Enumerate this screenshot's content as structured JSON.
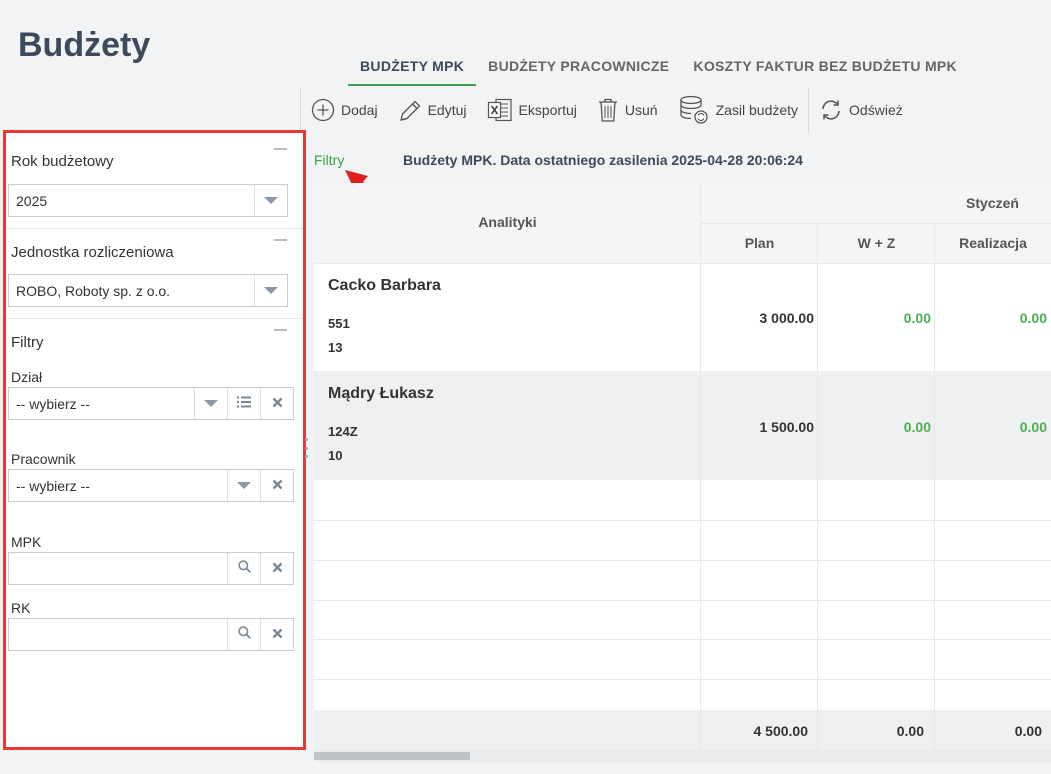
{
  "page": {
    "title": "Budżety"
  },
  "tabs": [
    "BUDŻETY MPK",
    "BUDŻETY PRACOWNICZE",
    "KOSZTY FAKTUR BEZ BUDŻETU MPK"
  ],
  "toolbar": {
    "add": "Dodaj",
    "edit": "Edytuj",
    "export": "Eksportuj",
    "delete": "Usuń",
    "feed": "Zasil budżety",
    "refresh": "Odśwież"
  },
  "sidebar": {
    "year_title": "Rok budżetowy",
    "year_value": "2025",
    "unit_title": "Jednostka rozliczeniowa",
    "unit_value": "ROBO, Roboty sp. z o.o.",
    "filters_title": "Filtry",
    "dept_label": "Dział",
    "dept_value": "-- wybierz --",
    "employee_label": "Pracownik",
    "employee_value": "-- wybierz --",
    "mpk_label": "MPK",
    "mpk_value": "",
    "rk_label": "RK",
    "rk_value": ""
  },
  "main": {
    "filters_link": "Filtry",
    "info": "Budżety MPK. Data ostatniego zasilenia 2025-04-28 20:06:24"
  },
  "table": {
    "analytics_header": "Analityki",
    "month_header": "Styczeń",
    "col_plan": "Plan",
    "col_wz": "W + Z",
    "col_real": "Realizacja",
    "rows": [
      {
        "name": "Cacko Barbara",
        "line1": "551",
        "line2": "13",
        "plan": "3 000.00",
        "wz": "0.00",
        "real": "0.00"
      },
      {
        "name": "Mądry Łukasz",
        "line1": "124Z",
        "line2": "10",
        "plan": "1 500.00",
        "wz": "0.00",
        "real": "0.00"
      }
    ],
    "totals": {
      "plan": "4 500.00",
      "wz": "0.00",
      "real": "0.00"
    }
  },
  "colors": {
    "accent": "#3aa24a",
    "highlight_border": "#e53935",
    "heading": "#3d4a5c"
  }
}
